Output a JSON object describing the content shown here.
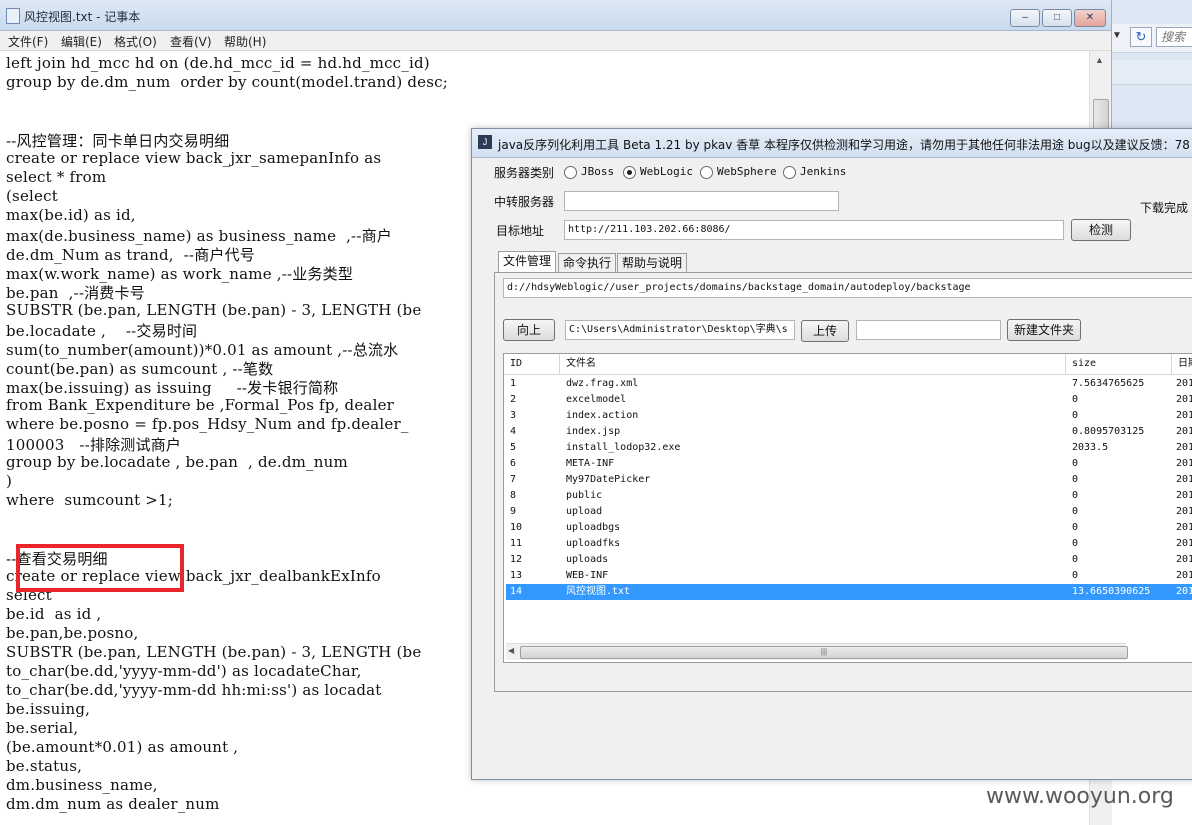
{
  "notepad": {
    "title": "风控视图.txt - 记事本",
    "menu": [
      "文件(F)",
      "编辑(E)",
      "格式(O)",
      "查看(V)",
      "帮助(H)"
    ],
    "lines": [
      "left join hd_mcc hd on (de.hd_mcc_id = hd.hd_mcc_id)",
      "group by de.dm_num  order by count(model.trand) desc;",
      "",
      "",
      "--风控管理：同卡单日内交易明细",
      "create or replace view back_jxr_samepanInfo as",
      "select * from",
      "(select",
      "max(be.id) as id,",
      "max(de.business_name) as business_name  ,--商户",
      "de.dm_Num as trand,  --商户代号",
      "max(w.work_name) as work_name ,--业务类型",
      "be.pan  ,--消费卡号",
      "SUBSTR (be.pan, LENGTH (be.pan) - 3, LENGTH (be",
      "be.locadate ,    --交易时间",
      "sum(to_number(amount))*0.01 as amount ,--总流水",
      "count(be.pan) as sumcount , --笔数",
      "max(be.issuing) as issuing     --发卡银行简称",
      "from Bank_Expenditure be ,Formal_Pos fp, dealer",
      "where be.posno = fp.pos_Hdsy_Num and fp.dealer_",
      "100003   --排除测试商户",
      "group by be.locadate , be.pan  , de.dm_num",
      ")",
      "where  sumcount >1;",
      "",
      "",
      "--查看交易明细",
      "create or replace view back_jxr_dealbankExInfo",
      "select",
      "be.id  as id ,",
      "be.pan,be.posno,",
      "SUBSTR (be.pan, LENGTH (be.pan) - 3, LENGTH (be",
      "to_char(be.dd,'yyyy-mm-dd') as locadateChar,",
      "to_char(be.dd,'yyyy-mm-dd hh:mi:ss') as locadat",
      "be.issuing,",
      "be.serial,",
      "(be.amount*0.01) as amount ,",
      "be.status,",
      "dm.business_name,",
      "dm.dm_num as dealer_num"
    ]
  },
  "explorer_fragment": {
    "search_placeholder": "搜索"
  },
  "tool": {
    "title": "java反序列化利用工具 Beta 1.21 by pkav 香草   本程序仅供检测和学习用途，请勿用于其他任何非法用途 bug以及建议反馈：78",
    "server_type_label": "服务器类别",
    "server_types": [
      "JBoss",
      "WebLogic",
      "WebSphere",
      "Jenkins"
    ],
    "selected_server": "WebLogic",
    "relay_label": "中转服务器",
    "relay_value": "",
    "target_label": "目标地址",
    "target_value": "http://211.103.202.66:8086/",
    "check_button": "检测",
    "download_status": "下载完成",
    "tabs": [
      "文件管理",
      "命令执行",
      "帮助与说明"
    ],
    "active_tab": "文件管理",
    "path_value": "d://hdsyWeblogic//user_projects/domains/backstage_domain/autodeploy/backstage",
    "up_button": "向上",
    "local_path": "C:\\Users\\Administrator\\Desktop\\字典\\s",
    "upload_button": "上传",
    "upload_extra": "",
    "new_folder_button": "新建文件夹",
    "table": {
      "columns": [
        "ID",
        "文件名",
        "size",
        "日期"
      ],
      "rows": [
        [
          "1",
          "dwz.frag.xml",
          "7.5634765625",
          "201"
        ],
        [
          "2",
          "excelmodel",
          "0",
          "201"
        ],
        [
          "3",
          "index.action",
          "0",
          "201"
        ],
        [
          "4",
          "index.jsp",
          "0.8095703125",
          "201"
        ],
        [
          "5",
          "install_lodop32.exe",
          "2033.5",
          "201"
        ],
        [
          "6",
          "META-INF",
          "0",
          "201"
        ],
        [
          "7",
          "My97DatePicker",
          "0",
          "201"
        ],
        [
          "8",
          "public",
          "0",
          "201"
        ],
        [
          "9",
          "upload",
          "0",
          "201"
        ],
        [
          "10",
          "uploadbgs",
          "0",
          "201"
        ],
        [
          "11",
          "uploadfks",
          "0",
          "201"
        ],
        [
          "12",
          "uploads",
          "0",
          "201"
        ],
        [
          "13",
          "WEB-INF",
          "0",
          "201"
        ],
        [
          "14",
          "风控视图.txt",
          "13.6650390625",
          "201"
        ]
      ],
      "selected_row": 14
    }
  },
  "watermark": "www.wooyun.org"
}
